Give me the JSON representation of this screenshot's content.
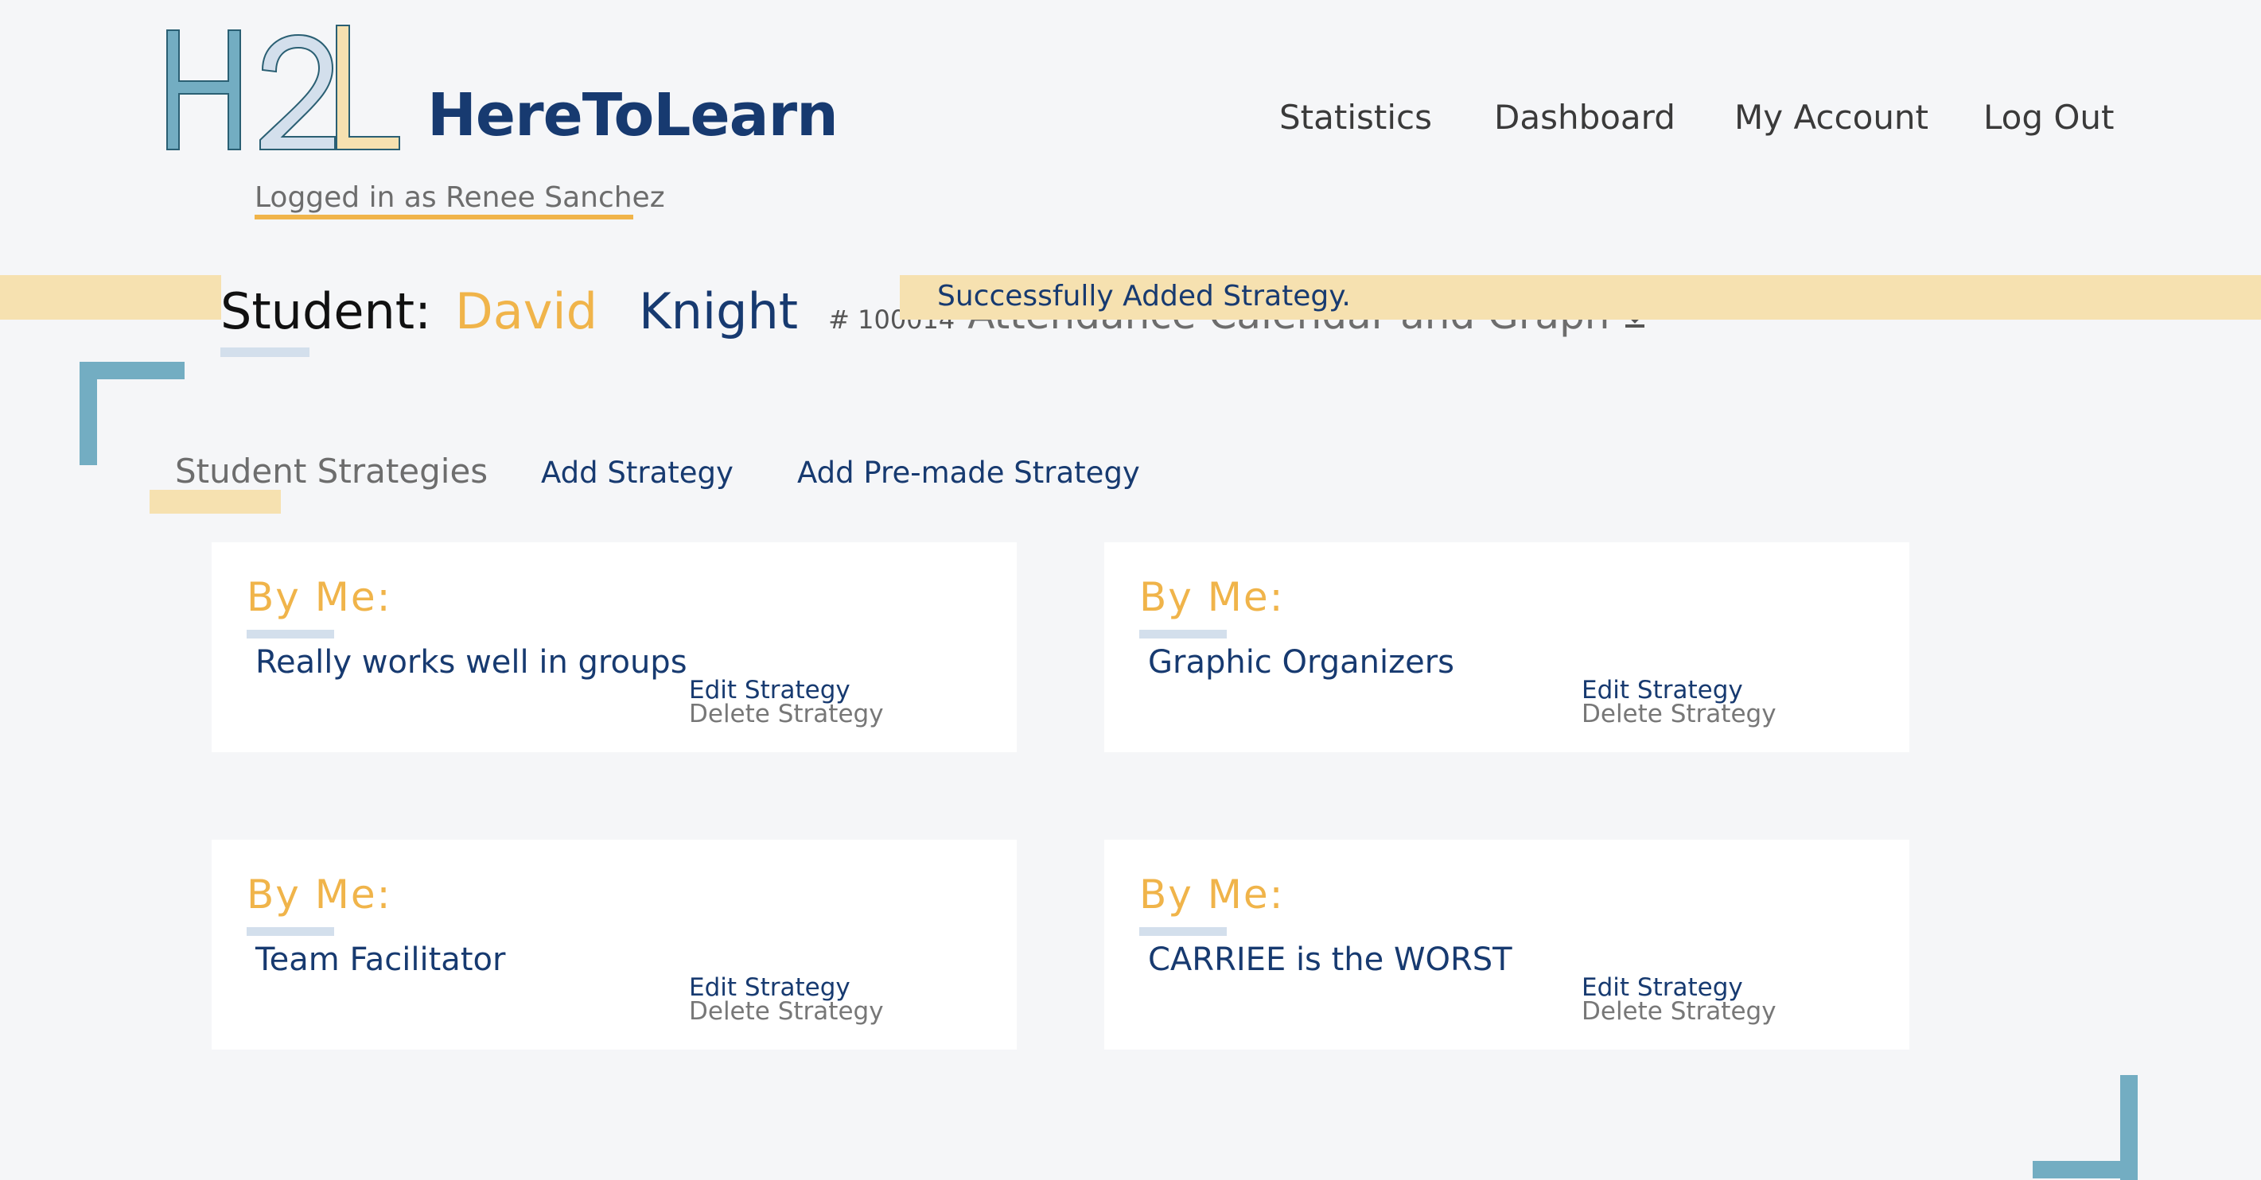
{
  "logo": {
    "letters": "H2L",
    "brand": "HereToLearn"
  },
  "nav": [
    "Statistics",
    "Dashboard",
    "My Account",
    "Log Out"
  ],
  "login_text": "Logged in as Renee Sanchez",
  "student": {
    "label": "Student:",
    "first_name": "David",
    "last_name": "Knight",
    "id": "# 100014",
    "attendance_link": "Attendance Calendar and Graph"
  },
  "flash_message": "Successfully Added Strategy.",
  "tabs": {
    "active": "Student Strategies",
    "add": "Add Strategy",
    "add_premade": "Add Pre-made Strategy"
  },
  "cards": [
    {
      "author": "By Me:",
      "name": "Really works well in groups",
      "edit": "Edit Strategy",
      "delete": "Delete Strategy"
    },
    {
      "author": "By Me:",
      "name": "Graphic Organizers",
      "edit": "Edit Strategy",
      "delete": "Delete Strategy"
    },
    {
      "author": "By Me:",
      "name": "Team Facilitator",
      "edit": "Edit Strategy",
      "delete": "Delete Strategy"
    },
    {
      "author": "By Me:",
      "name": "CARRIEE is the WORST",
      "edit": "Edit Strategy",
      "delete": "Delete Strategy"
    }
  ],
  "colors": {
    "navy": "#173a70",
    "gold": "#f0b44a",
    "teal": "#73adc2",
    "band": "#f6e1b0",
    "light_blue": "#d3dfec"
  },
  "icons": {
    "download": "download-icon"
  }
}
